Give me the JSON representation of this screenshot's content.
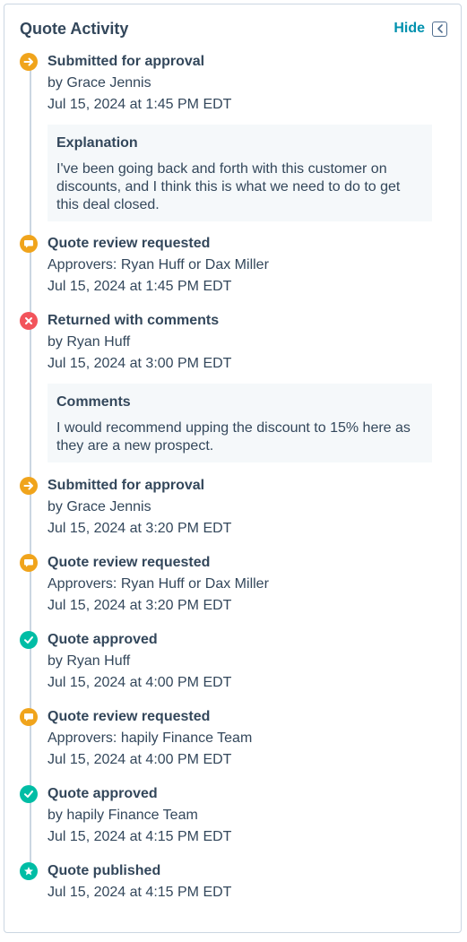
{
  "header": {
    "title": "Quote Activity",
    "hide_label": "Hide"
  },
  "colors": {
    "accent": "#0091ae",
    "orange": "#f0a41c",
    "red": "#f2545b",
    "green": "#00bda5",
    "text": "#33475b",
    "note_bg": "#f5f8fa"
  },
  "events": [
    {
      "icon": "arrow-right-icon",
      "title": "Submitted for approval",
      "line1": "by Grace Jennis",
      "line2": "Jul 15, 2024 at 1:45 PM EDT",
      "note": {
        "title": "Explanation",
        "body": "I've been going back and forth with this customer on discounts, and I think this is what we need to do to get this deal closed."
      }
    },
    {
      "icon": "comment-icon",
      "title": "Quote review requested",
      "line1": "Approvers: Ryan Huff or Dax Miller",
      "line2": "Jul 15, 2024 at 1:45 PM EDT"
    },
    {
      "icon": "x-icon",
      "title": "Returned with comments",
      "line1": "by Ryan Huff",
      "line2": "Jul 15, 2024 at 3:00 PM EDT",
      "note": {
        "title": "Comments",
        "body": "I would recommend upping the discount to 15% here as they are a new prospect."
      }
    },
    {
      "icon": "arrow-right-icon",
      "title": "Submitted for approval",
      "line1": "by Grace Jennis",
      "line2": "Jul 15, 2024 at 3:20 PM EDT"
    },
    {
      "icon": "comment-icon",
      "title": "Quote review requested",
      "line1": "Approvers: Ryan Huff or Dax Miller",
      "line2": "Jul 15, 2024 at 3:20 PM EDT"
    },
    {
      "icon": "check-icon",
      "title": "Quote approved",
      "line1": "by Ryan Huff",
      "line2": "Jul 15, 2024 at 4:00 PM EDT"
    },
    {
      "icon": "comment-icon",
      "title": "Quote review requested",
      "line1": "Approvers: hapily Finance Team",
      "line2": "Jul 15, 2024 at 4:00 PM EDT"
    },
    {
      "icon": "check-icon",
      "title": "Quote approved",
      "line1": "by hapily Finance Team",
      "line2": "Jul 15, 2024 at 4:15 PM EDT"
    },
    {
      "icon": "star-icon",
      "title": "Quote published",
      "line1": "Jul 15, 2024 at 4:15 PM EDT"
    }
  ]
}
